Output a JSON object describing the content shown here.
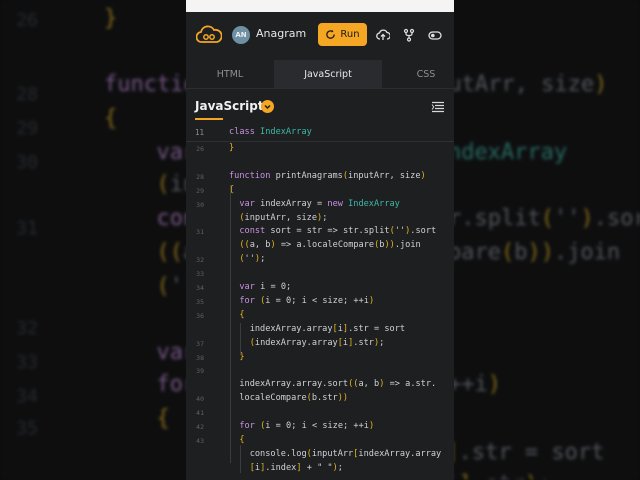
{
  "header": {
    "avatar_initials": "AN",
    "app_name": "Anagram",
    "run_label": "Run"
  },
  "tabs": [
    {
      "label": "HTML"
    },
    {
      "label": "JavaScript"
    },
    {
      "label": "CSS"
    }
  ],
  "language": {
    "title": "JavaScript"
  },
  "editor": {
    "sticky_line_number": "11",
    "sticky_code": "class IndexArray",
    "line_numbers": [
      "26",
      "",
      "28",
      "29",
      "30",
      "",
      "31",
      "",
      "32",
      "33",
      "34",
      "35",
      "36",
      "",
      "37",
      "38",
      "39",
      "",
      "40",
      "41",
      "42",
      "43",
      ""
    ],
    "lines": [
      "}",
      "",
      "function printAnagrams(inputArr, size)",
      "{",
      "  var indexArray = new IndexArray",
      "  (inputArr, size);",
      "  const sort = str => str.split('').sort",
      "  ((a, b) => a.localeCompare(b)).join",
      "  ('');",
      "",
      "  var i = 0;",
      "  for (i = 0; i < size; ++i)",
      "  {",
      "    indexArray.array[i].str = sort",
      "    (indexArray.array[i].str);",
      "  }",
      "",
      "  indexArray.array.sort((a, b) => a.str.",
      "  localeCompare(b.str))",
      "",
      "  for (i = 0; i < size; ++i)",
      "  {",
      "    console.log(inputArr[indexArray.array",
      "    [i].index] + \" \");"
    ]
  },
  "background": {
    "lines": [
      "}",
      "function printAnagrams(inputArr, size)",
      "{",
      "  var indexArray = new IndexArray",
      "  (inputArr, size);",
      "  const sort = str => str.split('').sort",
      "  ((a, b) => a.localeCompare(b)).join",
      "  ('');",
      "",
      "  var i = 0;",
      "  for (i = 0; i < size; ++i)",
      "  {",
      "    indexArray.array[i].str = sort",
      "    (indexArray.array[i].str);"
    ],
    "line_numbers": [
      "26",
      "28",
      "29",
      "30",
      "31",
      "32",
      "33",
      "34",
      "35"
    ]
  },
  "colors": {
    "accent": "#f5a623",
    "keyword": "#c991e1",
    "class_name": "#3fb7a7",
    "bracket": "#e6b422",
    "panel_bg": "#1e1f21"
  },
  "icons": [
    "codepen-cloud-logo-icon",
    "refresh-icon",
    "cloud-upload-icon",
    "fork-icon",
    "toggle-icon",
    "chevron-down-icon",
    "format-lines-icon"
  ]
}
